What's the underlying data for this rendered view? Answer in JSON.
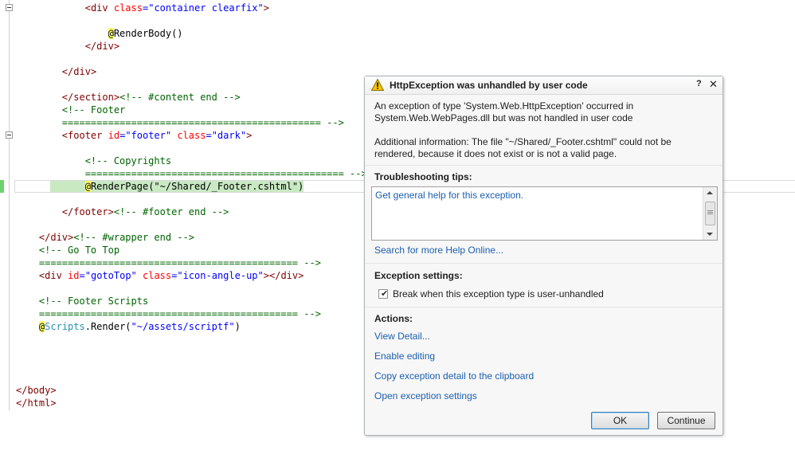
{
  "editor": {
    "lines": {
      "l1": {
        "a": "<",
        "b": "div",
        "c": " class",
        "d": "=",
        "e": "\"container clearfix\"",
        "f": ">"
      },
      "l3": {
        "razor": "@",
        "rest": "RenderBody()"
      },
      "l4": {
        "a": "</",
        "b": "div",
        "c": ">"
      },
      "l6": {
        "a": "</",
        "b": "div",
        "c": ">"
      },
      "l8": {
        "a": "</",
        "b": "section",
        "c": ">",
        "cmt": "<!-- #content end -->"
      },
      "l9": {
        "cmt": "<!-- Footer"
      },
      "l10": {
        "cmt": "============================================= -->"
      },
      "l11": {
        "a": "<",
        "b": "footer",
        "c": " id",
        "d": "=",
        "e": "\"footer\"",
        "f": " class",
        "g": "=",
        "h": "\"dark\"",
        "i": ">"
      },
      "l13": {
        "cmt": "<!-- Copyrights"
      },
      "l14": {
        "cmt": "============================================= -->"
      },
      "l15": {
        "razor": "@",
        "rest": "RenderPage(\"~/Shared/_Footer.cshtml\")"
      },
      "l17": {
        "a": "</",
        "b": "footer",
        "c": ">",
        "cmt": "<!-- #footer end -->"
      },
      "l19": {
        "a": "</",
        "b": "div",
        "c": ">",
        "cmt": "<!-- #wrapper end -->"
      },
      "l20": {
        "cmt": "<!-- Go To Top"
      },
      "l21": {
        "cmt": "============================================= -->"
      },
      "l22": {
        "a": "<",
        "b": "div",
        "c": " id",
        "d": "=",
        "e": "\"gotoTop\"",
        "f": " class",
        "g": "=",
        "h": "\"icon-angle-up\"",
        "i": "></",
        "j": "div",
        "k": ">"
      },
      "l24": {
        "cmt": "<!-- Footer Scripts"
      },
      "l25": {
        "cmt": "============================================= -->"
      },
      "l26": {
        "razor": "@",
        "ident": "Scripts",
        "rest": ".Render(",
        "str": "\"~/assets/scriptf\"",
        "close": ")"
      },
      "l31": {
        "a": "</",
        "b": "body",
        "c": ">"
      },
      "l32": {
        "a": "</",
        "b": "html",
        "c": ">"
      }
    }
  },
  "popup": {
    "title": "HttpException was unhandled by user code",
    "help_label": "?",
    "close_label": "✕",
    "message_1": "An exception of type 'System.Web.HttpException' occurred in System.Web.WebPages.dll but was not handled in user code",
    "message_2": "Additional information: The file \"~/Shared/_Footer.cshtml\" could not be rendered, because it does not exist or is not a valid page.",
    "troubleshooting_heading": "Troubleshooting tips:",
    "tips": [
      "Get general help for this exception."
    ],
    "search_link": "Search for more Help Online...",
    "exception_settings_heading": "Exception settings:",
    "break_checkbox_label": "Break when this exception type is user-unhandled",
    "break_checked": true,
    "actions_heading": "Actions:",
    "actions": [
      "View Detail...",
      "Enable editing",
      "Copy exception detail to the clipboard",
      "Open exception settings"
    ],
    "ok_label": "OK",
    "continue_label": "Continue"
  },
  "colors": {
    "link": "#1c5fb0",
    "tag": "#800000",
    "attribute": "#ff0000",
    "string": "#0000ff",
    "comment": "#006400",
    "razor_highlight": "#ffff66",
    "changed_line": "#c9e9c3"
  },
  "icons": {
    "warning": "warning-icon"
  }
}
